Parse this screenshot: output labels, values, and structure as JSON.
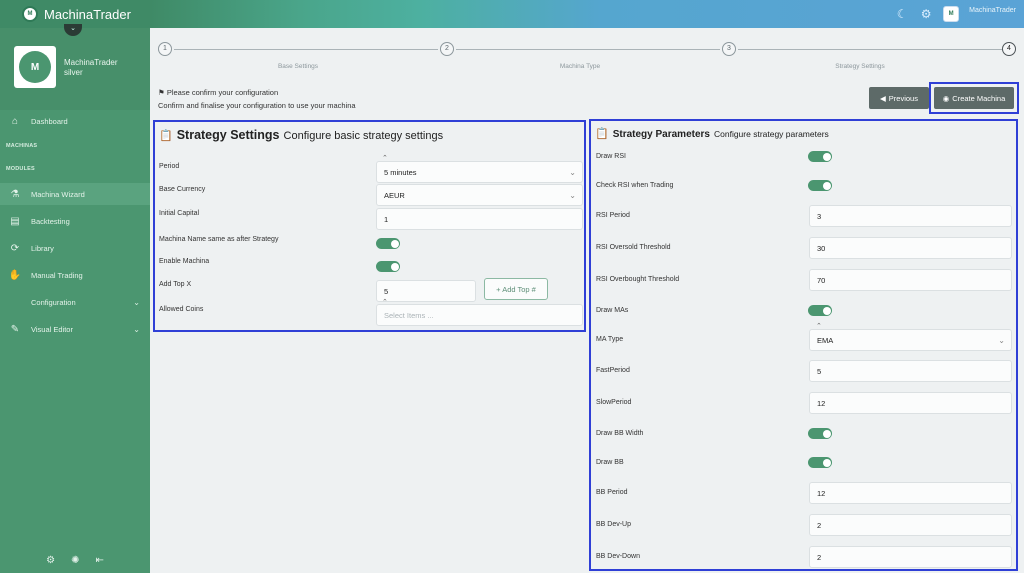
{
  "app": {
    "name": "MachinaTrader"
  },
  "topbar": {
    "theme_icon": "moon-icon",
    "settings_icon": "gear-icon",
    "user_name": "MachinaTrader"
  },
  "profile": {
    "name": "MachinaTrader",
    "role": "silver",
    "avatar_text": "M"
  },
  "sidebar": {
    "dashboard": "Dashboard",
    "section_machinas": "MACHINAS",
    "section_modules": "MODULES",
    "items": [
      {
        "label": "Machina Wizard",
        "icon": "wizard-icon"
      },
      {
        "label": "Backtesting",
        "icon": "document-icon"
      },
      {
        "label": "Library",
        "icon": "share-icon"
      },
      {
        "label": "Manual Trading",
        "icon": "hand-icon"
      },
      {
        "label": "Configuration",
        "icon": ""
      },
      {
        "label": "Visual Editor",
        "icon": "wrench-icon"
      }
    ]
  },
  "stepper": {
    "steps": [
      {
        "num": "1",
        "label": "Base Settings"
      },
      {
        "num": "2",
        "label": "Machina Type"
      },
      {
        "num": "3",
        "label": "Strategy Settings"
      },
      {
        "num": "4",
        "label": ""
      }
    ]
  },
  "confirm": {
    "line1": "Please confirm your configuration",
    "line2": "Confirm and finalise your configuration to use your machina"
  },
  "buttons": {
    "previous": "Previous",
    "create": "Create Machina"
  },
  "strategy_settings": {
    "title": "Strategy Settings",
    "subtitle": "Configure basic strategy settings",
    "period_label": "Period",
    "period_value": "5 minutes",
    "base_currency_label": "Base Currency",
    "base_currency_value": "AEUR",
    "initial_capital_label": "Initial Capital",
    "initial_capital_value": "1",
    "name_same_label": "Machina Name same as after Strategy",
    "name_same_on": true,
    "enable_label": "Enable Machina",
    "enable_on": true,
    "add_top_label": "Add Top X",
    "add_top_value": "5",
    "add_top_button": "+ Add Top #",
    "allowed_coins_label": "Allowed Coins",
    "allowed_coins_placeholder": "Select Items ..."
  },
  "strategy_params": {
    "title": "Strategy Parameters",
    "subtitle": "Configure strategy parameters",
    "draw_rsi": "Draw RSI",
    "check_rsi": "Check RSI when Trading",
    "rsi_period": "RSI Period",
    "rsi_period_value": "3",
    "rsi_oversold": "RSI Oversold Threshold",
    "rsi_oversold_value": "30",
    "rsi_overbought": "RSI Overbought Threshold",
    "rsi_overbought_value": "70",
    "draw_mas": "Draw MAs",
    "ma_type": "MA Type",
    "ma_type_value": "EMA",
    "fast_period": "FastPeriod",
    "fast_period_value": "5",
    "slow_period": "SlowPeriod",
    "slow_period_value": "12",
    "draw_bb_width": "Draw BB Width",
    "draw_bb": "Draw BB",
    "bb_period": "BB Period",
    "bb_period_value": "12",
    "bb_dev_up": "BB Dev-Up",
    "bb_dev_up_value": "2",
    "bb_dev_down": "BB Dev-Down",
    "bb_dev_down_value": "2"
  },
  "colors": {
    "brand_green": "#4b9670",
    "highlight_blue": "#2f3fd6",
    "button_gray": "#5d6a68"
  }
}
